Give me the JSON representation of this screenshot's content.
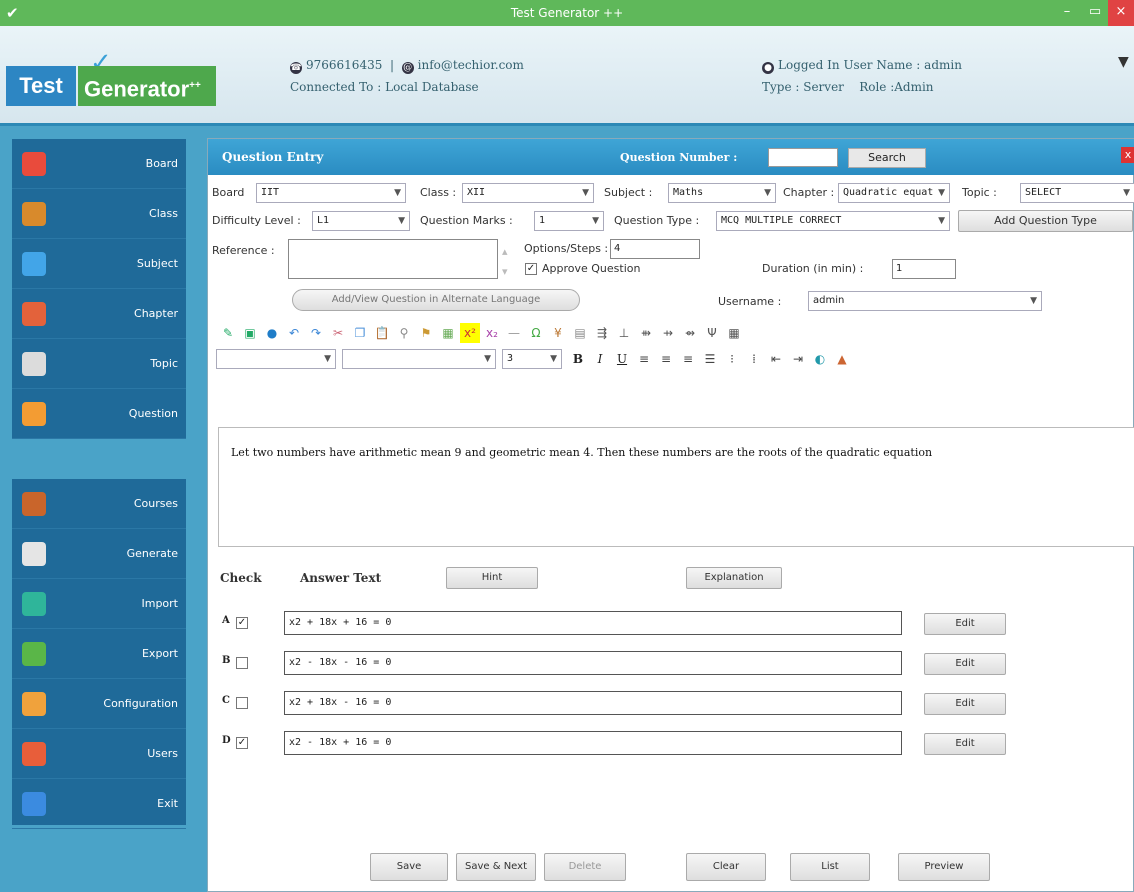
{
  "window": {
    "title": "Test Generator ++",
    "min": "–",
    "max": "▭",
    "close": "×"
  },
  "header": {
    "logo_part1": "Test",
    "logo_part2": "Generator",
    "logo_suffix": "++",
    "phone": "9766616435",
    "email": "info@techior.com",
    "connected_label": "Connected To :",
    "connected_value": "Local Database",
    "logged_in": "Logged In User Name : admin",
    "type": "Type : Server",
    "role": "Role :Admin"
  },
  "sidebar": {
    "top": [
      {
        "label": "Board",
        "color": "#e94b3c"
      },
      {
        "label": "Class",
        "color": "#d88a2c"
      },
      {
        "label": "Subject",
        "color": "#42a5e8"
      },
      {
        "label": "Chapter",
        "color": "#e3623b"
      },
      {
        "label": "Topic",
        "color": "#dcdcdc"
      },
      {
        "label": "Question",
        "color": "#f39c33"
      }
    ],
    "bottom": [
      {
        "label": "Courses",
        "color": "#c9652b"
      },
      {
        "label": "Generate",
        "color": "#e5e5e5"
      },
      {
        "label": "Import",
        "color": "#2fb59a"
      },
      {
        "label": "Export",
        "color": "#5ab648"
      },
      {
        "label": "Configuration",
        "color": "#f0a23c"
      },
      {
        "label": "Users",
        "color": "#e85e3a"
      },
      {
        "label": "Exit",
        "color": "#3b8be0"
      }
    ]
  },
  "panel": {
    "title": "Question Entry",
    "qnum_label": "Question Number :",
    "search_label": "Search",
    "close": "x",
    "board_label": "Board",
    "board_value": "IIT",
    "class_label": "Class :",
    "class_value": "XII",
    "subject_label": "Subject :",
    "subject_value": "Maths",
    "chapter_label": "Chapter :",
    "chapter_value": "Quadratic equat",
    "topic_label": "Topic :",
    "topic_value": "SELECT",
    "difficulty_label": "Difficulty Level :",
    "difficulty_value": "L1",
    "marks_label": "Question Marks :",
    "marks_value": "1",
    "qtype_label": "Question Type :",
    "qtype_value": "MCQ MULTIPLE CORRECT",
    "add_qtype_label": "Add Question Type",
    "reference_label": "Reference :",
    "options_label": "Options/Steps :",
    "options_value": "4",
    "approve_label": "Approve Question",
    "duration_label": "Duration (in min) :",
    "duration_value": "1",
    "alt_lang_label": "Add/View Question in Alternate Language",
    "username_label": "Username :",
    "username_value": "admin",
    "font_size_value": "3",
    "question_text": "Let two numbers have arithmetic mean 9 and geometric mean 4. Then these numbers are the roots of the quadratic equation"
  },
  "answers": {
    "check_header": "Check",
    "answer_header": "Answer Text",
    "hint_label": "Hint",
    "explanation_label": "Explanation",
    "edit_label": "Edit",
    "rows": [
      {
        "letter": "A",
        "checked": true,
        "text": "x2 + 18x + 16 = 0"
      },
      {
        "letter": "B",
        "checked": false,
        "text": "x2 - 18x - 16 = 0"
      },
      {
        "letter": "C",
        "checked": false,
        "text": "x2 + 18x - 16 = 0"
      },
      {
        "letter": "D",
        "checked": true,
        "text": "x2 - 18x + 16 = 0"
      }
    ]
  },
  "footer": {
    "save": "Save",
    "save_next": "Save & Next",
    "delete": "Delete",
    "clear": "Clear",
    "list": "List",
    "preview": "Preview"
  }
}
